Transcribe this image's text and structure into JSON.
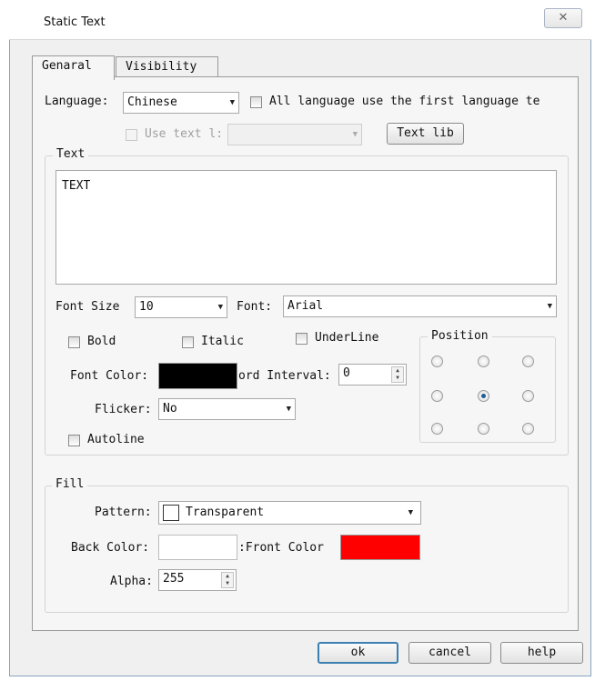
{
  "window": {
    "title": "Static Text",
    "close_symbol": "✕"
  },
  "tabs": [
    {
      "label": "Genaral"
    },
    {
      "label": "Visibility"
    }
  ],
  "language": {
    "label": "Language:",
    "selected": "Chinese",
    "all_lang_label": "All language use the first language te"
  },
  "use_text_lib": {
    "label": "Use text l:",
    "value": ""
  },
  "text_lib_button": "Text lib",
  "text_group": {
    "title": "Text",
    "content": "TEXT"
  },
  "font_size": {
    "label": "Font Size",
    "value": "10"
  },
  "font": {
    "label": "Font:",
    "value": "Arial"
  },
  "styles": {
    "bold": "Bold",
    "italic": "Italic",
    "underline": "UnderLine"
  },
  "position": {
    "title": "Position",
    "selected": "middle-center"
  },
  "font_color": {
    "label": "Font Color:",
    "color": "#000000"
  },
  "word_interval": {
    "label": "ord Interval:",
    "value": "0"
  },
  "flicker": {
    "label": "Flicker:",
    "value": "No"
  },
  "autoline": {
    "label": "Autoline"
  },
  "fill": {
    "title": "Fill",
    "pattern_label": "Pattern:",
    "pattern_value": "Transparent",
    "back_color_label": "Back Color:",
    "back_color": "#ffffff",
    "front_color_label": "Front Color:",
    "front_color": "#ff0000",
    "alpha_label": "Alpha:",
    "alpha_value": "255"
  },
  "footer": {
    "ok": "ok",
    "cancel": "cancel",
    "help": "help"
  },
  "colors": {
    "accent_border": "#3c7fb1",
    "radio_dot": "#1e5e98"
  }
}
